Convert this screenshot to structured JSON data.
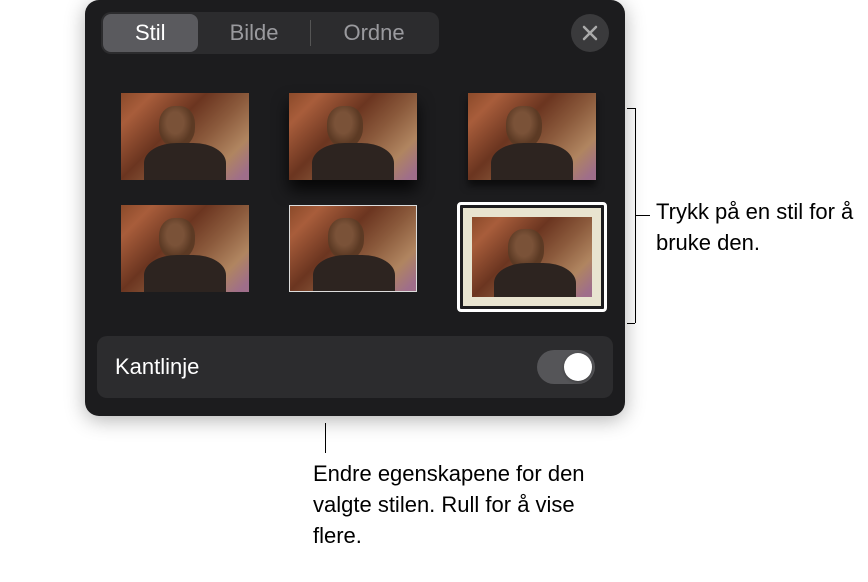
{
  "tabs": {
    "stil": "Stil",
    "bilde": "Bilde",
    "ordne": "Ordne"
  },
  "border": {
    "label": "Kantlinje"
  },
  "callouts": {
    "right": "Trykk på en stil for å bruke den.",
    "bottom": "Endre egenskapene for den valgte stilen. Rull for å vise flere."
  }
}
